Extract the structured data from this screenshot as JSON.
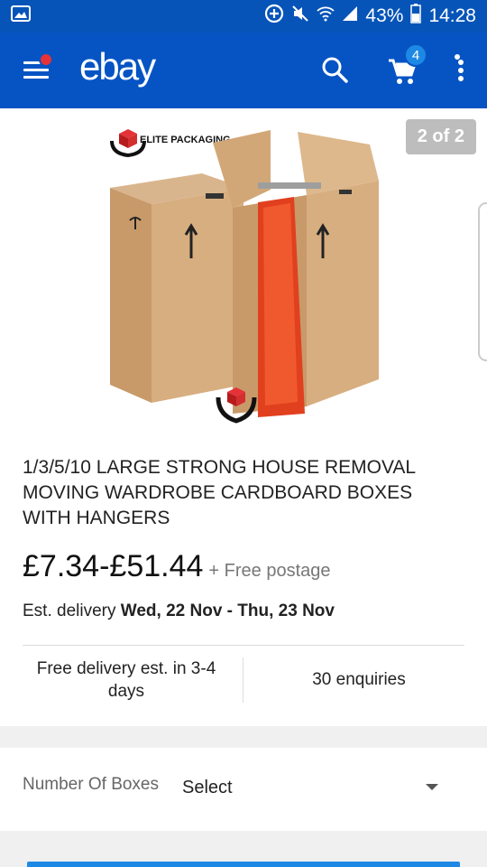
{
  "status_bar": {
    "battery": "43%",
    "time": "14:28",
    "icons": [
      "gallery-icon",
      "data-saver-icon",
      "mute-icon",
      "wifi-icon",
      "signal-icon",
      "battery-icon"
    ]
  },
  "app_bar": {
    "logo": "ebay",
    "cart_count": "4",
    "icons": [
      "menu-icon",
      "search-icon",
      "cart-icon",
      "more-icon"
    ]
  },
  "product": {
    "image_counter": "2 of 2",
    "image_brand": "ELITE PACKAGING",
    "title": "1/3/5/10 LARGE STRONG HOUSE REMOVAL MOVING WARDROBE CARDBOARD BOXES WITH HANGERS",
    "price": "£7.34-£51.44",
    "postage": "+ Free postage",
    "delivery_label": "Est. delivery",
    "delivery_dates": "Wed, 22 Nov - Thu, 23 Nov",
    "free_delivery": "Free delivery est. in 3-4 days",
    "enquiries": "30 enquiries"
  },
  "variation": {
    "label": "Number Of Boxes",
    "value": "Select"
  },
  "colors": {
    "brand_blue": "#0654c4",
    "status_blue": "#0654b8",
    "badge_red": "#e53238",
    "accent_blue": "#1e88e5"
  }
}
